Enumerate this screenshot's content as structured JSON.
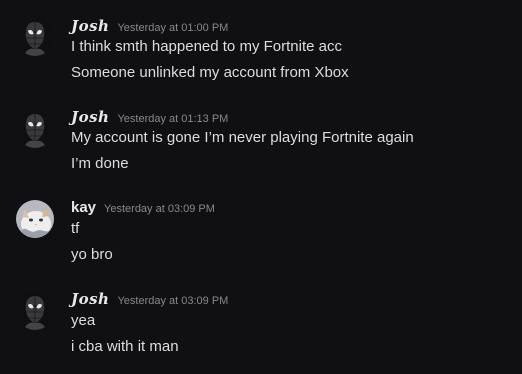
{
  "messages": [
    {
      "author": "𝑱𝒐𝒔𝒉",
      "timestamp": "Yesterday at 01:00 PM",
      "lines": [
        "I think smth happened to my Fortnite acc",
        "Someone unlinked my account from Xbox"
      ]
    },
    {
      "author": "𝑱𝒐𝒔𝒉",
      "timestamp": "Yesterday at 01:13 PM",
      "lines": [
        "My account is gone I’m never playing Fortnite again",
        "I’m done"
      ]
    },
    {
      "author": "kay",
      "timestamp": "Yesterday at 03:09 PM",
      "lines": [
        "tf",
        "yo bro"
      ]
    },
    {
      "author": "𝑱𝒐𝒔𝒉",
      "timestamp": "Yesterday at 03:09 PM",
      "lines": [
        "yea",
        "i cba with it man"
      ]
    }
  ]
}
